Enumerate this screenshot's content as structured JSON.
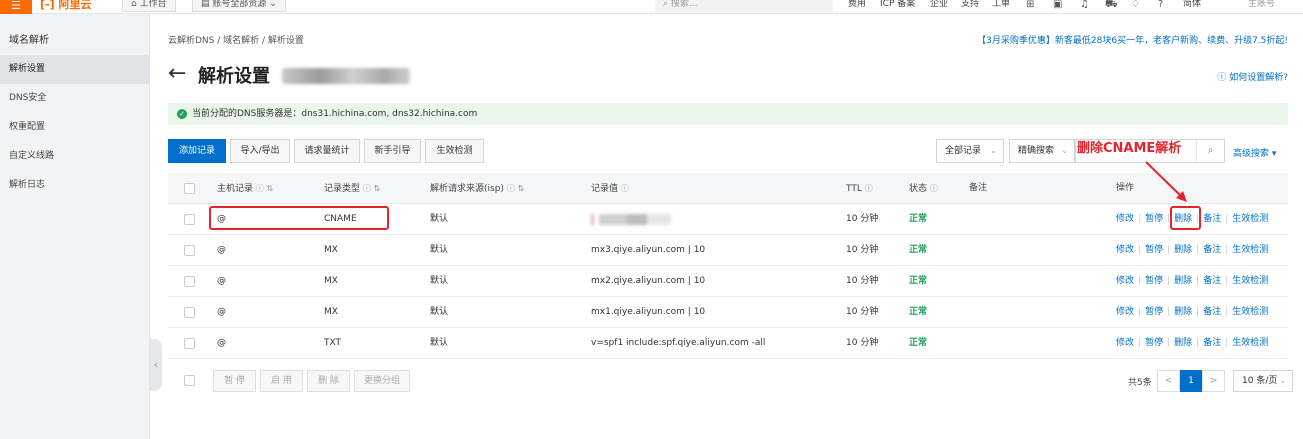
{
  "topbar": {
    "menu_icon": "☰",
    "logo": "[-] 阿里云",
    "workbench": "⌂ 工作台",
    "account_switch": "▤ 账号全部资源 ⌄",
    "search_placeholder": "搜索...",
    "links": [
      "费用",
      "ICP 备案",
      "企业",
      "支持",
      "工单",
      "简体"
    ],
    "user": "主账号"
  },
  "sidebar": {
    "title": "域名解析",
    "items": [
      "解析设置",
      "DNS安全",
      "权重配置",
      "自定义线路",
      "解析日志"
    ]
  },
  "breadcrumb": "云解析DNS  /  域名解析  /  解析设置",
  "promo": "【3月采购季优惠】新客最低28块6买一年，老客户新购、续费、升级7.5折起!",
  "page_title": "解析设置",
  "help_link": "ⓘ 如何设置解析?",
  "notice": "当前分配的DNS服务器是：dns31.hichina.com, dns32.hichina.com",
  "toolbar": {
    "add": "添加记录",
    "import_export": "导入/导出",
    "stats": "请求量统计",
    "guide": "新手引导",
    "check": "生效检测",
    "all_records": "全部记录",
    "precise_search": "精确搜索",
    "advanced_search": "高级搜索 ▾"
  },
  "annotation": "删除CNAME解析",
  "columns": {
    "host": "主机记录",
    "type": "记录类型",
    "source": "解析请求来源(isp)",
    "value": "记录值",
    "ttl": "TTL",
    "status": "状态",
    "remark": "备注",
    "ops": "操作"
  },
  "rows": [
    {
      "host": "@",
      "type": "CNAME",
      "source": "默认",
      "value": "",
      "ttl": "10 分钟",
      "status": "正常"
    },
    {
      "host": "@",
      "type": "MX",
      "source": "默认",
      "value": "mx3.qiye.aliyun.com | 10",
      "ttl": "10 分钟",
      "status": "正常"
    },
    {
      "host": "@",
      "type": "MX",
      "source": "默认",
      "value": "mx2.qiye.aliyun.com | 10",
      "ttl": "10 分钟",
      "status": "正常"
    },
    {
      "host": "@",
      "type": "MX",
      "source": "默认",
      "value": "mx1.qiye.aliyun.com | 10",
      "ttl": "10 分钟",
      "status": "正常"
    },
    {
      "host": "@",
      "type": "TXT",
      "source": "默认",
      "value": "v=spf1 include:spf.qiye.aliyun.com -all",
      "ttl": "10 分钟",
      "status": "正常"
    }
  ],
  "row_actions": {
    "edit": "修改",
    "pause": "暂停",
    "delete": "删除",
    "remark": "备注",
    "check": "生效检测"
  },
  "footer": {
    "pause": "暂 停",
    "enable": "启 用",
    "delete": "删 除",
    "change_group": "更换分组",
    "total": "共5条",
    "prev": "<",
    "page": "1",
    "next": ">",
    "page_size": "10 条/页"
  },
  "colors": {
    "primary": "#0070cc",
    "ok": "#22a35a",
    "annotation": "#e5242b",
    "brand": "#ff6a00"
  }
}
